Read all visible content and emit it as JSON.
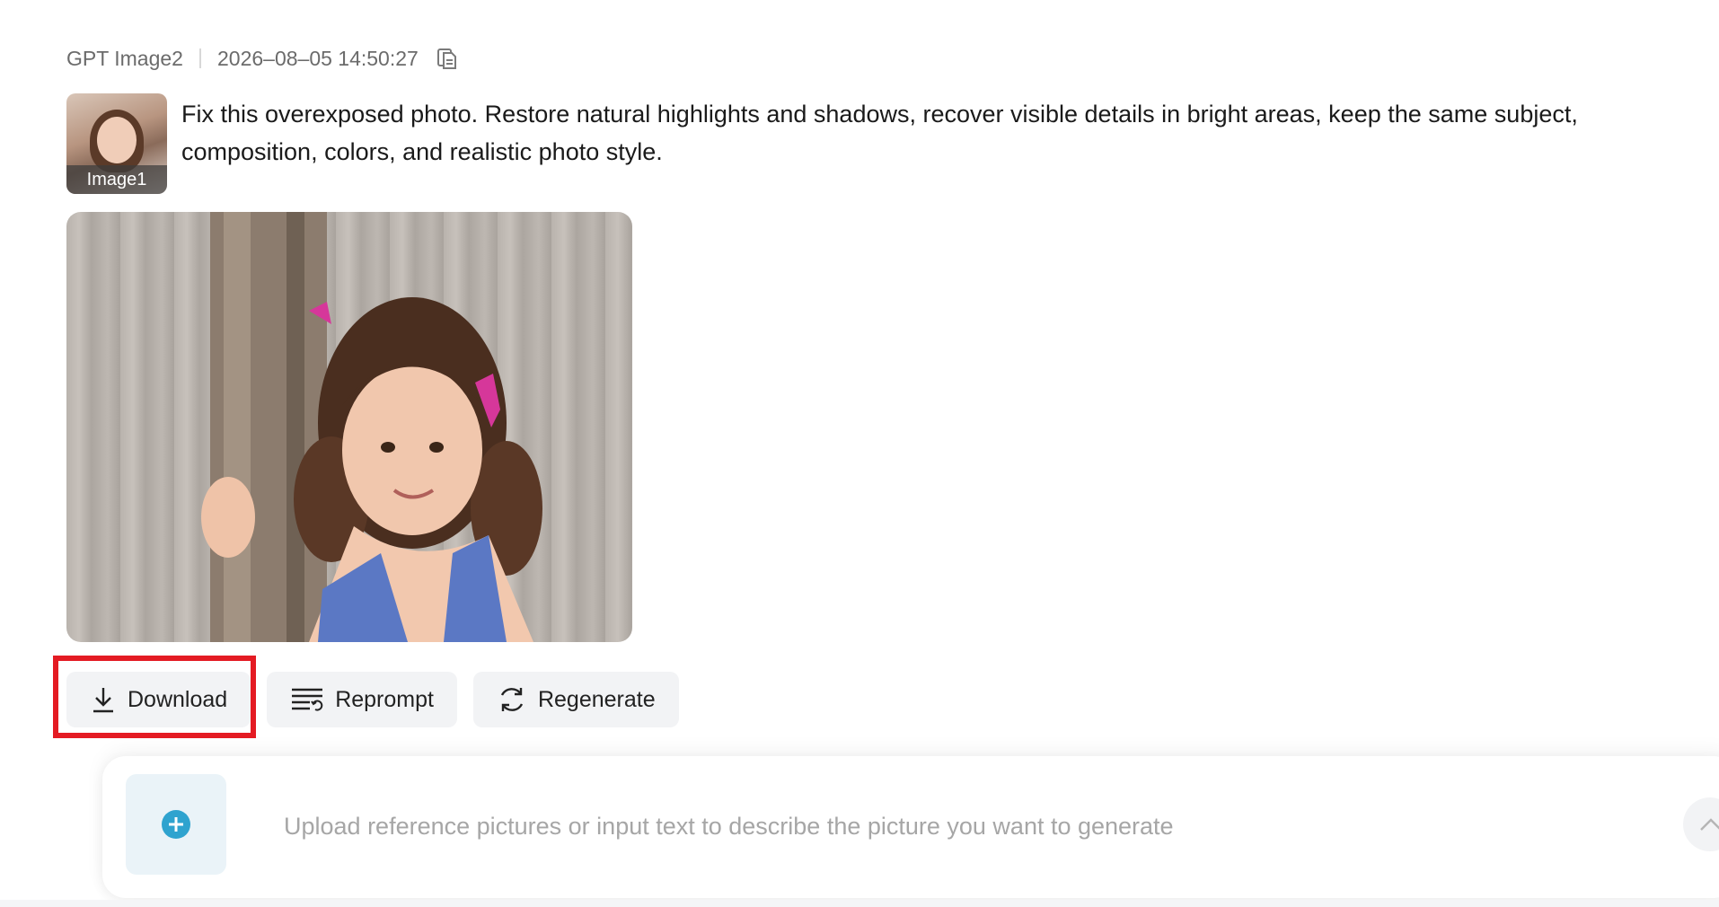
{
  "meta": {
    "model": "GPT Image2",
    "timestamp": "2026–08–05 14:50:27"
  },
  "reference": {
    "label": "Image1"
  },
  "prompt": {
    "text": "Fix this overexposed photo. Restore natural highlights and shadows, recover visible details in bright areas, keep the same subject, composition, colors, and realistic photo style."
  },
  "actions": {
    "download": "Download",
    "reprompt": "Reprompt",
    "regenerate": "Regenerate"
  },
  "input": {
    "placeholder": "Upload reference pictures or input text to describe the picture you want to generate"
  },
  "icons": {
    "copy": "copy-icon",
    "download": "download-icon",
    "reprompt": "reprompt-icon",
    "regenerate": "regenerate-icon",
    "upload": "plus-circle-icon",
    "expand": "chevron-up-icon"
  },
  "colors": {
    "highlight": "#e41b23",
    "upload_accent": "#2fa3cf",
    "button_bg": "#f2f3f5"
  }
}
